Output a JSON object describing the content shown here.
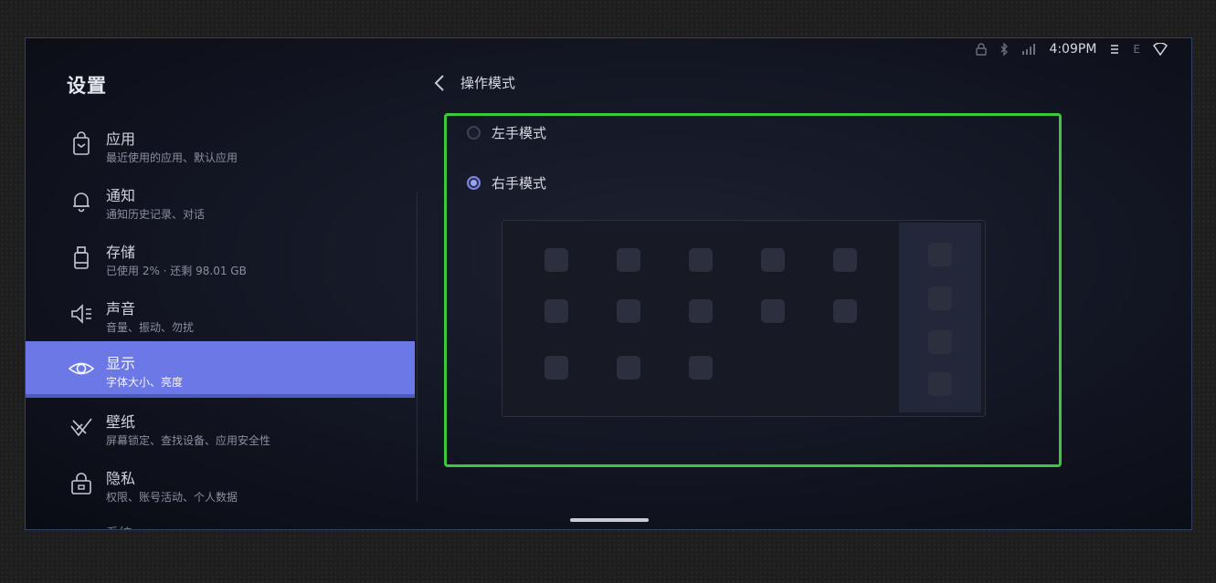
{
  "status_bar": {
    "time": "4:09PM",
    "icons": [
      "lock-icon",
      "bluetooth-icon",
      "signal-icon",
      "sync-icon",
      "wifi-icon"
    ],
    "extra_text": "E"
  },
  "sidebar": {
    "title": "设置",
    "items": [
      {
        "icon": "app-bag-icon",
        "title": "应用",
        "subtitle": "最近使用的应用、默认应用",
        "active": false
      },
      {
        "icon": "bell-icon",
        "title": "通知",
        "subtitle": "通知历史记录、对话",
        "active": false
      },
      {
        "icon": "storage-icon",
        "title": "存储",
        "subtitle": "已使用 2% · 还剩 98.01 GB",
        "active": false
      },
      {
        "icon": "speaker-icon",
        "title": "声音",
        "subtitle": "音量、振动、勿扰",
        "active": false
      },
      {
        "icon": "eye-icon",
        "title": "显示",
        "subtitle": "字体大小、亮度",
        "active": true
      },
      {
        "icon": "wallpaper-icon",
        "title": "壁纸",
        "subtitle": "屏幕锁定、查找设备、应用安全性",
        "active": false
      },
      {
        "icon": "privacy-lock-icon",
        "title": "隐私",
        "subtitle": "权限、账号活动、个人数据",
        "active": false
      }
    ],
    "peek_item": "系统"
  },
  "header": {
    "title": "操作模式",
    "back_icon": "chevron-left-icon"
  },
  "options": [
    {
      "label": "左手模式",
      "checked": false
    },
    {
      "label": "右手模式",
      "checked": true
    }
  ],
  "colors": {
    "accent": "#6b78e5",
    "highlight_border": "#3cc83c",
    "background": "#121522"
  }
}
